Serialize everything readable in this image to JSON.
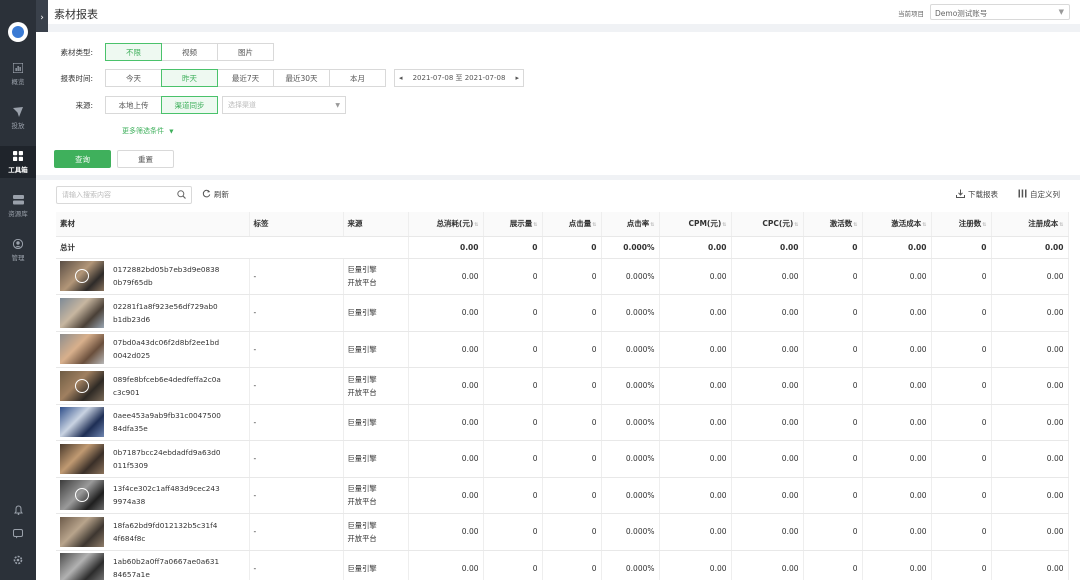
{
  "page_title": "素材报表",
  "project": {
    "label": "当前项目",
    "value": "Demo测试账号"
  },
  "sidebar": [
    {
      "label": "概览",
      "icon": "chart-icon"
    },
    {
      "label": "投放",
      "icon": "send-icon"
    },
    {
      "label": "工具箱",
      "icon": "grid-icon",
      "active": true
    },
    {
      "label": "资源库",
      "icon": "database-icon"
    },
    {
      "label": "管理",
      "icon": "user-icon"
    }
  ],
  "filters": {
    "material_type": {
      "label": "素材类型:",
      "options": [
        "不限",
        "视频",
        "图片"
      ],
      "selected": "不限"
    },
    "report_time": {
      "label": "报表时间:",
      "options": [
        "今天",
        "昨天",
        "最近7天",
        "最近30天",
        "本月"
      ],
      "selected": "昨天",
      "date_range": "2021-07-08 至 2021-07-08"
    },
    "source": {
      "label": "来源:",
      "options": [
        "本地上传",
        "渠道同步"
      ],
      "selected": "渠道同步",
      "channel_placeholder": "选择渠道"
    },
    "more": "更多筛选条件",
    "query_label": "查询",
    "reset_label": "重置"
  },
  "toolbar": {
    "search_placeholder": "请输入搜索内容",
    "refresh": "刷新",
    "download": "下载报表",
    "custom": "自定义列"
  },
  "table": {
    "headers": [
      "素材",
      "标签",
      "来源",
      "总消耗(元)",
      "展示量",
      "点击量",
      "点击率",
      "CPM(元)",
      "CPC(元)",
      "激活数",
      "激活成本",
      "注册数",
      "注册成本"
    ],
    "total": {
      "label": "总计",
      "values": [
        "0.00",
        "0",
        "0",
        "0.000%",
        "0.00",
        "0.00",
        "0",
        "0.00",
        "0",
        "0.00"
      ]
    },
    "rows": [
      {
        "id": "0172882bd05b7eb3d9e08380b79f65db",
        "tag": "-",
        "source": [
          "巨量引擎",
          "开放平台"
        ],
        "values": [
          "0.00",
          "0",
          "0",
          "0.000%",
          "0.00",
          "0.00",
          "0",
          "0.00",
          "0",
          "0.00"
        ]
      },
      {
        "id": "02281f1a8f923e56df729ab0b1db23d6",
        "tag": "-",
        "source": [
          "巨量引擎"
        ],
        "values": [
          "0.00",
          "0",
          "0",
          "0.000%",
          "0.00",
          "0.00",
          "0",
          "0.00",
          "0",
          "0.00"
        ]
      },
      {
        "id": "07bd0a43dc06f2d8bf2ee1bd0042d025",
        "tag": "-",
        "source": [
          "巨量引擎"
        ],
        "values": [
          "0.00",
          "0",
          "0",
          "0.000%",
          "0.00",
          "0.00",
          "0",
          "0.00",
          "0",
          "0.00"
        ]
      },
      {
        "id": "089fe8bfceb6e4dedfeffa2c0ac3c901",
        "tag": "-",
        "source": [
          "巨量引擎",
          "开放平台"
        ],
        "values": [
          "0.00",
          "0",
          "0",
          "0.000%",
          "0.00",
          "0.00",
          "0",
          "0.00",
          "0",
          "0.00"
        ]
      },
      {
        "id": "0aee453a9ab9fb31c004750084dfa35e",
        "tag": "-",
        "source": [
          "巨量引擎"
        ],
        "values": [
          "0.00",
          "0",
          "0",
          "0.000%",
          "0.00",
          "0.00",
          "0",
          "0.00",
          "0",
          "0.00"
        ]
      },
      {
        "id": "0b7187bcc24ebdadfd9a63d0011f5309",
        "tag": "-",
        "source": [
          "巨量引擎"
        ],
        "values": [
          "0.00",
          "0",
          "0",
          "0.000%",
          "0.00",
          "0.00",
          "0",
          "0.00",
          "0",
          "0.00"
        ]
      },
      {
        "id": "13f4ce302c1aff483d9cec2439974a38",
        "tag": "-",
        "source": [
          "巨量引擎",
          "开放平台"
        ],
        "values": [
          "0.00",
          "0",
          "0",
          "0.000%",
          "0.00",
          "0.00",
          "0",
          "0.00",
          "0",
          "0.00"
        ]
      },
      {
        "id": "18fa62bd9fd012132b5c31f44f684f8c",
        "tag": "-",
        "source": [
          "巨量引擎",
          "开放平台"
        ],
        "values": [
          "0.00",
          "0",
          "0",
          "0.000%",
          "0.00",
          "0.00",
          "0",
          "0.00",
          "0",
          "0.00"
        ]
      },
      {
        "id": "1ab60b2a0ff7a0667ae0a63184657a1e",
        "tag": "-",
        "source": [
          "巨量引擎"
        ],
        "values": [
          "0.00",
          "0",
          "0",
          "0.000%",
          "0.00",
          "0.00",
          "0",
          "0.00",
          "0",
          "0.00"
        ]
      }
    ]
  }
}
